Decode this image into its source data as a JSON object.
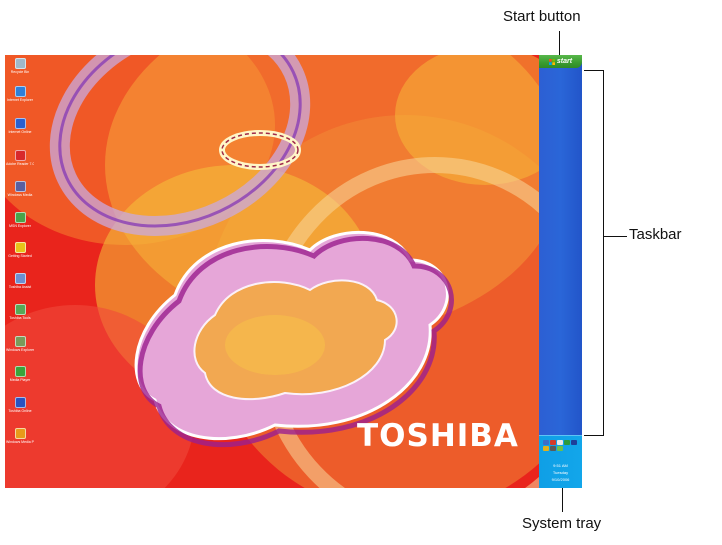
{
  "callouts": {
    "start_button": "Start button",
    "taskbar": "Taskbar",
    "system_tray": "System tray"
  },
  "desktop": {
    "brand_text": "TOSHIBA",
    "icons": [
      {
        "label": "Recycle Bin",
        "icon": "recycle-bin-icon",
        "color": "#9fb8c9"
      },
      {
        "label": "Internet Explorer",
        "icon": "internet-explorer-icon",
        "color": "#2f7fd8"
      },
      {
        "label": "Internet Online",
        "icon": "internet-online-icon",
        "color": "#2a5fd0"
      },
      {
        "label": "Adobe Reader 7.0",
        "icon": "adobe-reader-icon",
        "color": "#d8282c"
      },
      {
        "label": "Windows Media",
        "icon": "media-icon",
        "color": "#5a5fa0"
      },
      {
        "label": "MSN Explorer",
        "icon": "msn-icon",
        "color": "#4aa34a"
      },
      {
        "label": "Getting Started",
        "icon": "getting-started-icon",
        "color": "#e8c21a"
      },
      {
        "label": "Toshiba Assist",
        "icon": "toshiba-assist-icon",
        "color": "#6d8fd1"
      },
      {
        "label": "Toshiba Tools",
        "icon": "toshiba-tools-icon",
        "color": "#57a857"
      },
      {
        "label": "Windows Explorer",
        "icon": "windows-explorer-icon",
        "color": "#7a9a5a"
      },
      {
        "label": "Media Player",
        "icon": "media-player-icon",
        "color": "#3aa33a"
      },
      {
        "label": "Toshiba Online",
        "icon": "toshiba-online-icon",
        "color": "#2a52c0"
      },
      {
        "label": "Windows Media Player",
        "icon": "windows-media-player-icon",
        "color": "#e89a1a"
      }
    ]
  },
  "taskbar": {
    "start_label": "start",
    "tray_time": "9:51 AM",
    "tray_day": "Tuesday",
    "tray_date": "9/10/2006"
  },
  "colors": {
    "taskbar_blue": "#2a66d8",
    "start_green": "#3a9b30",
    "tray_blue": "#12a6ea",
    "wallpaper_red": "#e9241c"
  }
}
